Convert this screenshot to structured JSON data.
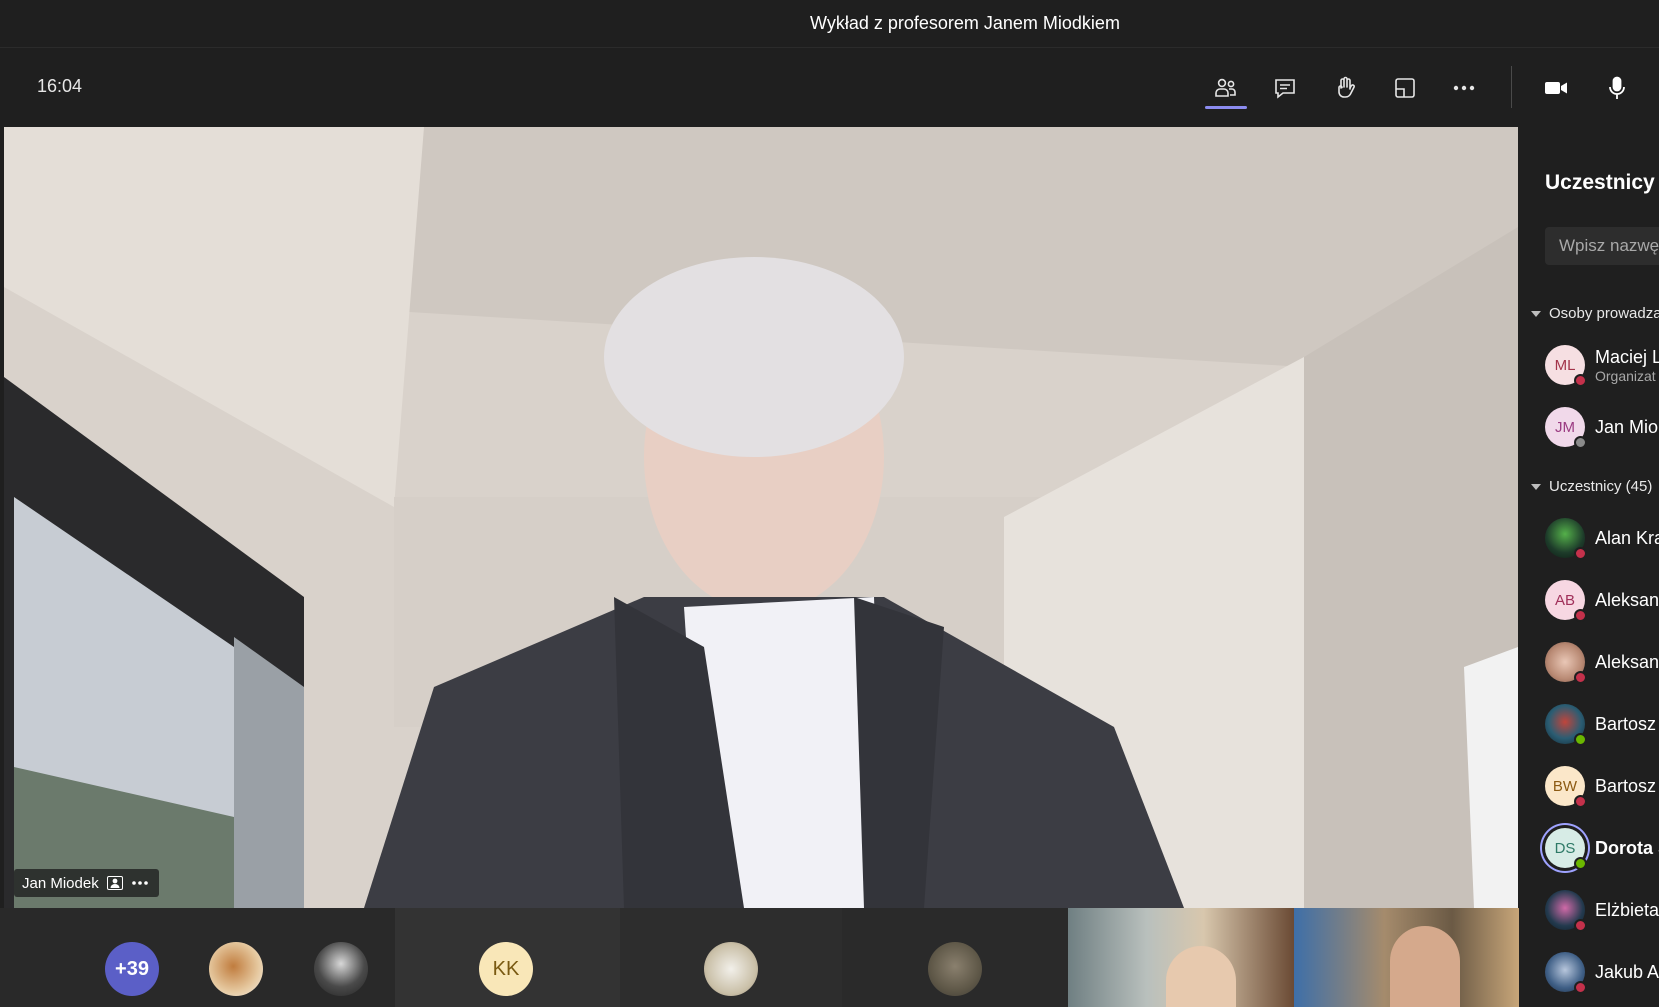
{
  "window": {
    "title": "Wykład z profesorem Janem Miodkiem"
  },
  "toolbar": {
    "time": "16:04",
    "buttons": [
      {
        "name": "participants-icon",
        "active": true
      },
      {
        "name": "chat-icon"
      },
      {
        "name": "raise-hand-icon"
      },
      {
        "name": "rooms-icon"
      },
      {
        "name": "more-options-icon"
      },
      {
        "name": "camera-icon"
      },
      {
        "name": "microphone-icon"
      }
    ],
    "accent": "#8c8cf0"
  },
  "stage": {
    "speaker_name": "Jan Miodek"
  },
  "strip": {
    "overflow_count": "+39",
    "tiles": [
      {
        "initials": "KK",
        "color": "#f9e7b8",
        "text_color": "#7a5a12"
      }
    ]
  },
  "panel": {
    "title": "Uczestnicy",
    "search_placeholder": "Wpisz nazwę",
    "sections": [
      {
        "label": "Osoby prowadzą"
      },
      {
        "label": "Uczestnicy (45)"
      }
    ],
    "organizers": [
      {
        "initials": "ML",
        "name": "Maciej L",
        "role": "Organizat",
        "bg": "#f6dfe2",
        "fg": "#a3344a",
        "status": "#c4314b"
      },
      {
        "initials": "JM",
        "name": "Jan Mio",
        "role": "",
        "bg": "#f1d9ea",
        "fg": "#9b3b82",
        "status": "#8a8a8a"
      }
    ],
    "attendees": [
      {
        "initials": "",
        "name": "Alan Kra",
        "bg": "#1d3b2a",
        "fg": "#fff",
        "status": "#c4314b",
        "photo": true
      },
      {
        "initials": "AB",
        "name": "Aleksand",
        "bg": "#f7d7e2",
        "fg": "#a0305a",
        "status": "#c4314b"
      },
      {
        "initials": "",
        "name": "Aleksand",
        "bg": "#c99a86",
        "fg": "#fff",
        "status": "#c4314b",
        "photo": true
      },
      {
        "initials": "",
        "name": "Bartosz",
        "bg": "#2b5d73",
        "fg": "#fff",
        "status": "#6bb700",
        "photo": true
      },
      {
        "initials": "BW",
        "name": "Bartosz",
        "bg": "#fbe7c9",
        "fg": "#8c5a12",
        "status": "#c4314b"
      },
      {
        "initials": "DS",
        "name": "Dorota S",
        "bg": "#d7ece6",
        "fg": "#2e7a67",
        "status": "#6bb700",
        "bold": true
      },
      {
        "initials": "",
        "name": "Elżbieta",
        "bg": "#233a4e",
        "fg": "#fff",
        "status": "#c4314b",
        "photo": true
      },
      {
        "initials": "",
        "name": "Jakub Au",
        "bg": "#3f5f86",
        "fg": "#fff",
        "status": "#c4314b",
        "photo": true
      }
    ]
  }
}
